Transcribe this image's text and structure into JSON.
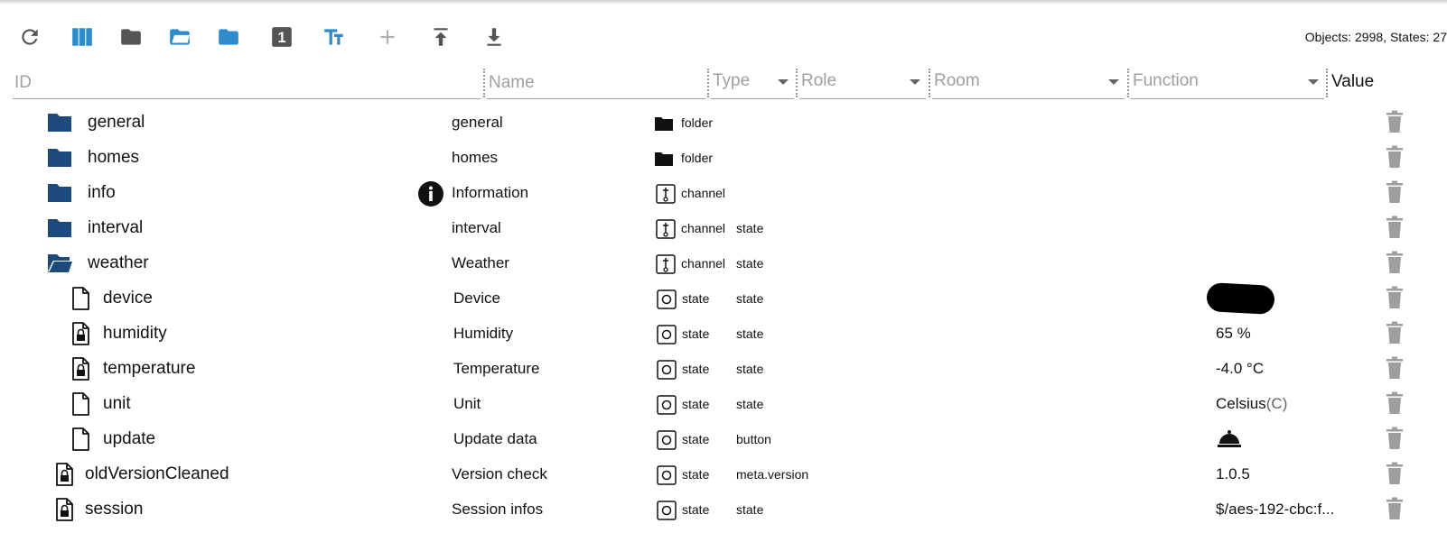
{
  "toolbar": {
    "buttons": [
      {
        "name": "refresh-icon"
      },
      {
        "name": "columns-icon"
      },
      {
        "name": "folder-icon"
      },
      {
        "name": "folder-open-icon"
      },
      {
        "name": "folder-blue-icon"
      },
      {
        "name": "number-one-icon",
        "label": "1"
      },
      {
        "name": "text-size-icon"
      },
      {
        "name": "plus-icon"
      },
      {
        "name": "upload-icon"
      },
      {
        "name": "download-icon"
      }
    ],
    "counts": "Objects: 2998, States: 27"
  },
  "header": {
    "id_placeholder": "ID",
    "name_placeholder": "Name",
    "type_label": "Type",
    "role_label": "Role",
    "room_label": "Room",
    "function_label": "Function",
    "value_label": "Value"
  },
  "rows": [
    {
      "id": "general",
      "name": "general",
      "type": "folder",
      "role": "",
      "value": ""
    },
    {
      "id": "homes",
      "name": "homes",
      "type": "folder",
      "role": "",
      "value": ""
    },
    {
      "id": "info",
      "name": "Information",
      "type": "channel",
      "role": "",
      "value": ""
    },
    {
      "id": "interval",
      "name": "interval",
      "type": "channel",
      "role": "state",
      "value": ""
    },
    {
      "id": "weather",
      "name": "Weather",
      "type": "channel",
      "role": "state",
      "value": ""
    },
    {
      "id": "device",
      "name": "Device",
      "type": "state",
      "role": "state",
      "value": ""
    },
    {
      "id": "humidity",
      "name": "Humidity",
      "type": "state",
      "role": "state",
      "value": "65",
      "unit": "%"
    },
    {
      "id": "temperature",
      "name": "Temperature",
      "type": "state",
      "role": "state",
      "value": "-4.0",
      "unit": "°C"
    },
    {
      "id": "unit",
      "name": "Unit",
      "type": "state",
      "role": "state",
      "value": "Celsius",
      "unit": "(C)"
    },
    {
      "id": "update",
      "name": "Update data",
      "type": "state",
      "role": "button",
      "value": ""
    },
    {
      "id": "oldVersionCleaned",
      "name": "Version check",
      "type": "state",
      "role": "meta.version",
      "value": "1.0.5"
    },
    {
      "id": "session",
      "name": "Session infos",
      "type": "state",
      "role": "state",
      "value": "$/aes-192-cbc:f..."
    }
  ],
  "colors": {
    "folder_dark": "#1c4a7c",
    "toolbar_blue": "#2e8bcc",
    "toolbar_gray": "#555555",
    "trash_gray": "#9e9e9e"
  }
}
